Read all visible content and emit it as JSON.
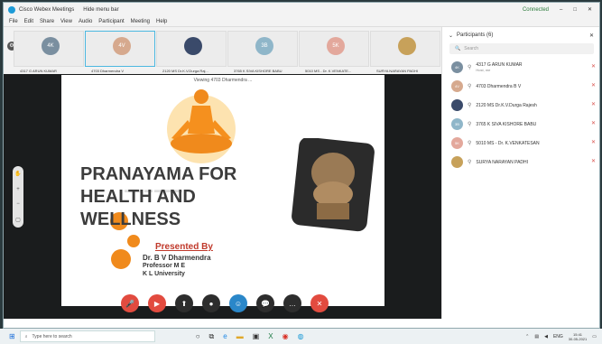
{
  "window": {
    "title": "Cisco Webex Meetings",
    "hide_menu": "Hide menu bar",
    "connected": "Connected",
    "controls": [
      "–",
      "□",
      "✕"
    ]
  },
  "menu": [
    "File",
    "Edit",
    "Share",
    "View",
    "Audio",
    "Participant",
    "Meeting",
    "Help"
  ],
  "thumbnails": [
    {
      "initials": "4K",
      "name": "4317 G ARUN KUMAR",
      "color": "#7a8fa0",
      "active": false
    },
    {
      "initials": "4V",
      "name": "4703 Dharmendra V",
      "color": "#d6a98e",
      "active": true
    },
    {
      "initials": "",
      "name": "2120 MS Dr.K.V.Durga Raj...",
      "color": "#3a4a6a",
      "active": false
    },
    {
      "initials": "3B",
      "name": "3765 K SIVA KISHORE BABU",
      "color": "#8fb6c9",
      "active": false
    },
    {
      "initials": "5K",
      "name": "5010 MS - Dr. K.VENKATE...",
      "color": "#e3a89c",
      "active": false
    },
    {
      "initials": "",
      "name": "SURYA NARAYAN PADHI",
      "color": "#c7a15a",
      "active": false
    }
  ],
  "slide": {
    "viewing": "Viewing 4703 Dharmendra ...",
    "title_lines": [
      "PRANAYAMA FOR",
      "HEALTH AND",
      "WELLNESS"
    ],
    "presented_by": "Presented By",
    "presenter_lines": [
      "Dr. B V Dharmendra",
      "Professor M E",
      "K L University"
    ]
  },
  "controls": [
    {
      "name": "mute",
      "color": "#e24b3f",
      "glyph": "🎤"
    },
    {
      "name": "video",
      "color": "#e24b3f",
      "glyph": "▶"
    },
    {
      "name": "share",
      "color": "#2d2d2d",
      "glyph": "⬆"
    },
    {
      "name": "record",
      "color": "#2d2d2d",
      "glyph": "●"
    },
    {
      "name": "participants",
      "color": "#2a87c9",
      "glyph": "☺"
    },
    {
      "name": "chat",
      "color": "#2d2d2d",
      "glyph": "💬"
    },
    {
      "name": "more",
      "color": "#2d2d2d",
      "glyph": "…"
    },
    {
      "name": "leave",
      "color": "#e24b3f",
      "glyph": "✕"
    }
  ],
  "participants": {
    "header": "Participants (6)",
    "search_placeholder": "Search",
    "list": [
      {
        "initials": "4K",
        "name": "4317 G ARUN KUMAR",
        "sub": "Host, me",
        "color": "#7a8fa0"
      },
      {
        "initials": "4V",
        "name": "4703 Dharmendra B V",
        "sub": "",
        "color": "#d6a98e"
      },
      {
        "initials": "",
        "name": "2120 MS Dr.K.V.Durga Rajesh",
        "sub": "",
        "color": "#3a4a6a"
      },
      {
        "initials": "3B",
        "name": "3765 K SIVA KISHORE BABU",
        "sub": "",
        "color": "#8fb6c9"
      },
      {
        "initials": "5K",
        "name": "5010 MS - Dr. K.VENKATESAN",
        "sub": "",
        "color": "#e3a89c"
      },
      {
        "initials": "",
        "name": "SURYA NARAYAN PADHI",
        "sub": "",
        "color": "#c7a15a"
      }
    ]
  },
  "taskbar": {
    "search_placeholder": "Type here to search",
    "lang": "ENG",
    "time": "15:41",
    "date": "30-05-2021"
  }
}
